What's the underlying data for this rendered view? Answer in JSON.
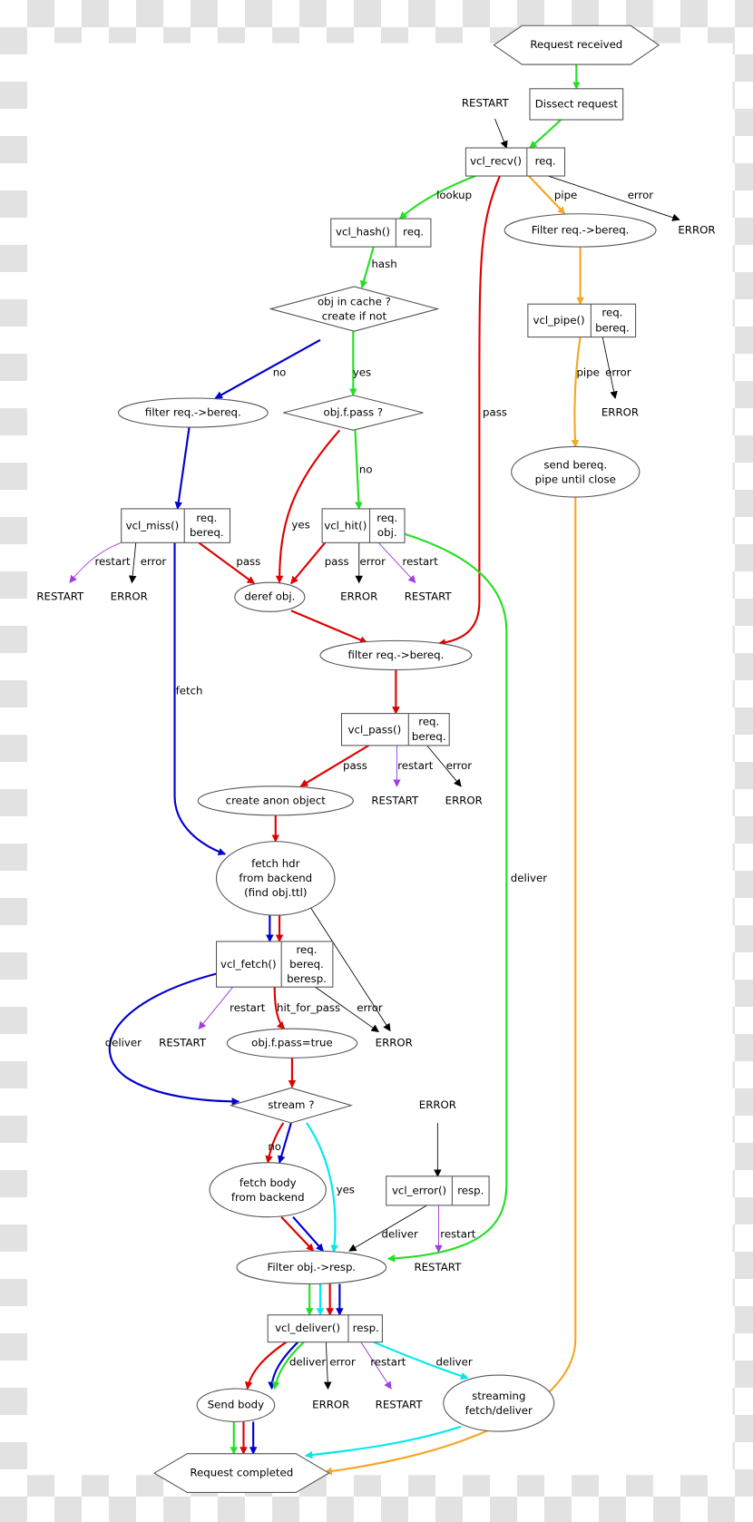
{
  "colors": {
    "green": "#22e022",
    "red": "#e00000",
    "blue": "#0000d0",
    "orange": "#f5a623",
    "cyan": "#00e8ee",
    "purple": "#a040e0",
    "black": "#000000"
  },
  "nodes": {
    "request_received": "Request received",
    "dissect_request": "Dissect request",
    "restart_top": "RESTART",
    "vcl_recv": {
      "fn": "vcl_recv()",
      "vars": "req."
    },
    "error_recv": "ERROR",
    "vcl_hash": {
      "fn": "vcl_hash()",
      "vars": "req."
    },
    "filter_pipe": "Filter req.->bereq.",
    "obj_in_cache": [
      "obj in cache ?",
      "create if not"
    ],
    "vcl_pipe": {
      "fn": "vcl_pipe()",
      "vars": [
        "req.",
        "bereq."
      ]
    },
    "error_pipe": "ERROR",
    "filter_miss": "filter req.->bereq.",
    "obj_f_pass": "obj.f.pass ?",
    "send_bereq": [
      "send bereq.",
      "pipe until close"
    ],
    "vcl_miss": {
      "fn": "vcl_miss()",
      "vars": [
        "req.",
        "bereq."
      ]
    },
    "vcl_hit": {
      "fn": "vcl_hit()",
      "vars": [
        "req.",
        "obj."
      ]
    },
    "restart_miss": "RESTART",
    "error_miss": "ERROR",
    "deref_obj": "deref obj.",
    "error_hit": "ERROR",
    "restart_hit": "RESTART",
    "filter_pass": "filter req.->bereq.",
    "vcl_pass": {
      "fn": "vcl_pass()",
      "vars": [
        "req.",
        "bereq."
      ]
    },
    "create_anon": "create anon object",
    "restart_pass": "RESTART",
    "error_pass": "ERROR",
    "fetch_hdr": [
      "fetch hdr",
      "from backend",
      "(find obj.ttl)"
    ],
    "vcl_fetch": {
      "fn": "vcl_fetch()",
      "vars": [
        "req.",
        "bereq.",
        "beresp."
      ]
    },
    "restart_fetch": "RESTART",
    "obj_pass_true": "obj.f.pass=true",
    "error_fetch": "ERROR",
    "stream": "stream ?",
    "error_in": "ERROR",
    "fetch_body": [
      "fetch body",
      "from backend"
    ],
    "vcl_error": {
      "fn": "vcl_error()",
      "vars": "resp."
    },
    "filter_resp": "Filter obj.->resp.",
    "restart_error": "RESTART",
    "vcl_deliver": {
      "fn": "vcl_deliver()",
      "vars": "resp."
    },
    "send_body": "Send body",
    "error_deliver": "ERROR",
    "restart_deliver": "RESTART",
    "streaming": [
      "streaming",
      "fetch/deliver"
    ],
    "request_completed": "Request completed"
  },
  "edge_labels": {
    "lookup": "lookup",
    "pass_recv": "pass",
    "pipe_recv": "pipe",
    "error_recv": "error",
    "hash": "hash",
    "no_cache": "no",
    "yes_cache": "yes",
    "pipe_pipe": "pipe",
    "error_pipe": "error",
    "yes_pass": "yes",
    "no_pass": "no",
    "restart_miss": "restart",
    "error_miss": "error",
    "pass_miss": "pass",
    "fetch_miss": "fetch",
    "pass_hit": "pass",
    "error_hit": "error",
    "restart_hit": "restart",
    "deliver_hit": "deliver",
    "pass_pass": "pass",
    "restart_pass": "restart",
    "error_pass": "error",
    "deliver_fetch": "deliver",
    "restart_fetch": "restart",
    "hit_for_pass": "hit_for_pass",
    "error_fetch": "error",
    "no_stream": "no",
    "yes_stream": "yes",
    "deliver_error": "deliver",
    "restart_error": "restart",
    "deliver_deliver": "deliver",
    "error_deliver": "error",
    "restart_deliver": "restart",
    "deliver_stream": "deliver"
  }
}
